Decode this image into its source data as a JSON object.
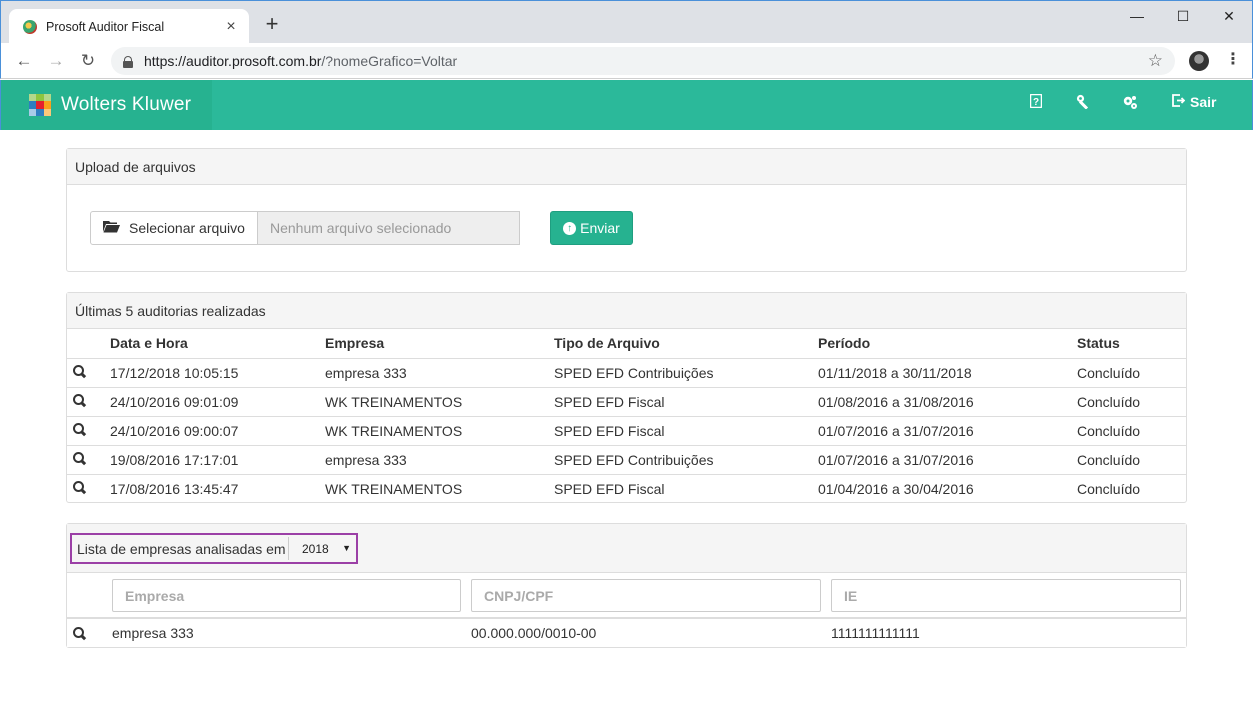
{
  "browser": {
    "tab_title": "Prosoft Auditor Fiscal",
    "url_host": "https://auditor.prosoft.com.br",
    "url_rest": "/?nomeGrafico=Voltar"
  },
  "header": {
    "brand": "Wolters Kluwer",
    "logout_label": "Sair"
  },
  "upload": {
    "title": "Upload de arquivos",
    "select_label": "Selecionar arquivo",
    "file_placeholder": "Nenhum arquivo selecionado",
    "send_label": "Enviar"
  },
  "audits": {
    "title": "Últimas 5 auditorias realizadas",
    "columns": [
      "Data e Hora",
      "Empresa",
      "Tipo de Arquivo",
      "Período",
      "Status"
    ],
    "rows": [
      [
        "17/12/2018 10:05:15",
        "empresa 333",
        "SPED EFD Contribuições",
        "01/11/2018 a 30/11/2018",
        "Concluído"
      ],
      [
        "24/10/2016 09:01:09",
        "WK TREINAMENTOS",
        "SPED EFD Fiscal",
        "01/08/2016 a 31/08/2016",
        "Concluído"
      ],
      [
        "24/10/2016 09:00:07",
        "WK TREINAMENTOS",
        "SPED EFD Fiscal",
        "01/07/2016 a 31/07/2016",
        "Concluído"
      ],
      [
        "19/08/2016 17:17:01",
        "empresa 333",
        "SPED EFD Contribuições",
        "01/07/2016 a 31/07/2016",
        "Concluído"
      ],
      [
        "17/08/2016 13:45:47",
        "WK TREINAMENTOS",
        "SPED EFD Fiscal",
        "01/04/2016 a 30/04/2016",
        "Concluído"
      ]
    ]
  },
  "companies": {
    "label": "Lista de empresas analisadas em",
    "year": "2018",
    "filters": {
      "empresa": "Empresa",
      "cnpj": "CNPJ/CPF",
      "ie": "IE"
    },
    "rows": [
      {
        "empresa": "empresa 333",
        "cnpj": "00.000.000/0010-00",
        "ie": "1111111111111"
      }
    ]
  }
}
